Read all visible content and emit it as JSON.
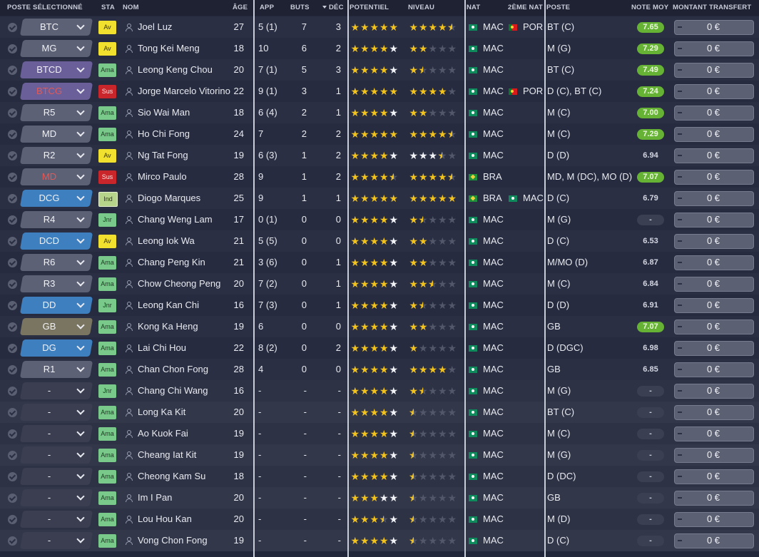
{
  "headers": {
    "poste_sel": "POSTE SÉLECTIONNÉ",
    "sta": "STA",
    "nom": "NOM",
    "age": "ÂGE",
    "app": "APP",
    "buts": "BUTS",
    "dec": "DÉC",
    "potentiel": "POTENTIEL",
    "niveau": "NIVEAU",
    "nat": "NAT",
    "nat2": "2ÈME NAT",
    "poste": "POSTE",
    "note": "NOTE MOY",
    "transfert": "MONTANT TRANSFERT"
  },
  "colors": {
    "accent_blue": "#3d7fbf",
    "status_av": "#f1e12e",
    "status_ama": "#79c98a",
    "status_sus": "#c8262a",
    "rating_green": "#66b234",
    "star_gold": "#f2c21d"
  },
  "players": [
    {
      "pos": "BTC",
      "pos_style": "grey",
      "pos_red": false,
      "status": "Av",
      "name": "Joel Luz",
      "age": "27",
      "app": "5 (1)",
      "buts": "7",
      "dec": "3",
      "potential": 5,
      "potential_color": "gold",
      "level": 4.5,
      "nat": "MAC",
      "nat2": "POR",
      "nat2_flag": "por",
      "poste": "BT (C)",
      "note": "7.65",
      "note_style": "good",
      "montant": "0 €"
    },
    {
      "pos": "MG",
      "pos_style": "grey",
      "pos_red": false,
      "status": "Av",
      "name": "Tong Kei Meng",
      "age": "18",
      "app": "10",
      "buts": "6",
      "dec": "2",
      "potential": 4,
      "potential_color": "white",
      "level": 2,
      "nat": "MAC",
      "nat2": "",
      "nat2_flag": "",
      "poste": "M (G)",
      "note": "7.29",
      "note_style": "good",
      "montant": "0 €"
    },
    {
      "pos": "BTCD",
      "pos_style": "purple",
      "pos_red": false,
      "status": "Ama",
      "name": "Leong Keng Chou",
      "age": "20",
      "app": "7 (1)",
      "buts": "5",
      "dec": "3",
      "potential": 4,
      "potential_color": "white",
      "level": 1.5,
      "nat": "MAC",
      "nat2": "",
      "nat2_flag": "",
      "poste": "BT (C)",
      "note": "7.49",
      "note_style": "good",
      "montant": "0 €"
    },
    {
      "pos": "BTCG",
      "pos_style": "purple",
      "pos_red": true,
      "status": "Sus",
      "name": "Jorge Marcelo Vitorino",
      "age": "22",
      "app": "9 (1)",
      "buts": "3",
      "dec": "1",
      "potential": 5,
      "potential_color": "gold",
      "level": 4,
      "nat": "MAC",
      "nat2": "POR",
      "nat2_flag": "por",
      "poste": "D (C), BT (C)",
      "note": "7.24",
      "note_style": "good",
      "montant": "0 €"
    },
    {
      "pos": "R5",
      "pos_style": "grey",
      "pos_red": false,
      "status": "Ama",
      "name": "Sio Wai Man",
      "age": "18",
      "app": "6 (4)",
      "buts": "2",
      "dec": "1",
      "potential": 4,
      "potential_color": "white",
      "level": 2,
      "nat": "MAC",
      "nat2": "",
      "nat2_flag": "",
      "poste": "M (C)",
      "note": "7.00",
      "note_style": "good",
      "montant": "0 €"
    },
    {
      "pos": "MD",
      "pos_style": "grey",
      "pos_red": false,
      "status": "Ama",
      "name": "Ho Chi Fong",
      "age": "24",
      "app": "7",
      "buts": "2",
      "dec": "2",
      "potential": 5,
      "potential_color": "gold",
      "level": 4.5,
      "nat": "MAC",
      "nat2": "",
      "nat2_flag": "",
      "poste": "M (C)",
      "note": "7.29",
      "note_style": "good",
      "montant": "0 €"
    },
    {
      "pos": "R2",
      "pos_style": "grey",
      "pos_red": false,
      "status": "Av",
      "name": "Ng Tat Fong",
      "age": "19",
      "app": "6 (3)",
      "buts": "1",
      "dec": "2",
      "potential": 4,
      "potential_color": "white",
      "level": 3.5,
      "level_grey": true,
      "nat": "MAC",
      "nat2": "",
      "nat2_flag": "",
      "poste": "D (D)",
      "note": "6.94",
      "note_style": "plain",
      "montant": "0 €"
    },
    {
      "pos": "MD",
      "pos_style": "grey",
      "pos_red": true,
      "status": "Sus",
      "name": "Mirco Paulo",
      "age": "28",
      "app": "9",
      "buts": "1",
      "dec": "2",
      "potential": 4.5,
      "potential_color": "gold",
      "level": 4.5,
      "nat": "BRA",
      "nat_flag": "bra",
      "nat2": "",
      "nat2_flag": "",
      "poste": "MD, M (DC), MO (D)",
      "note": "7.07",
      "note_style": "good",
      "montant": "0 €"
    },
    {
      "pos": "DCG",
      "pos_style": "blue",
      "pos_red": false,
      "status": "Ind",
      "name": "Diogo Marques",
      "age": "25",
      "app": "9",
      "buts": "1",
      "dec": "1",
      "potential": 5,
      "potential_color": "gold",
      "level": 5,
      "nat": "BRA",
      "nat_flag": "bra",
      "nat2": "MAC",
      "nat2_flag": "mac",
      "poste": "D (C)",
      "note": "6.79",
      "note_style": "plain",
      "montant": "0 €"
    },
    {
      "pos": "R4",
      "pos_style": "grey",
      "pos_red": false,
      "status": "Jnr",
      "name": "Chang Weng Lam",
      "age": "17",
      "app": "0 (1)",
      "buts": "0",
      "dec": "0",
      "potential": 4,
      "potential_color": "white",
      "level": 1.5,
      "nat": "MAC",
      "nat2": "",
      "nat2_flag": "",
      "poste": "M (G)",
      "note": "-",
      "note_style": "dash",
      "montant": "0 €"
    },
    {
      "pos": "DCD",
      "pos_style": "blue",
      "pos_red": false,
      "status": "Av",
      "name": "Leong Iok Wa",
      "age": "21",
      "app": "5 (5)",
      "buts": "0",
      "dec": "0",
      "potential": 4,
      "potential_color": "white",
      "level": 2,
      "nat": "MAC",
      "nat2": "",
      "nat2_flag": "",
      "poste": "D (C)",
      "note": "6.53",
      "note_style": "plain",
      "montant": "0 €"
    },
    {
      "pos": "R6",
      "pos_style": "grey",
      "pos_red": false,
      "status": "Ama",
      "name": "Chang Peng Kin",
      "age": "21",
      "app": "3 (6)",
      "buts": "0",
      "dec": "1",
      "potential": 4,
      "potential_color": "white",
      "level": 2,
      "nat": "MAC",
      "nat2": "",
      "nat2_flag": "",
      "poste": "M/MO (D)",
      "note": "6.87",
      "note_style": "plain",
      "montant": "0 €"
    },
    {
      "pos": "R3",
      "pos_style": "grey",
      "pos_red": false,
      "status": "Ama",
      "name": "Chow Cheong Peng",
      "age": "20",
      "app": "7 (2)",
      "buts": "0",
      "dec": "1",
      "potential": 4,
      "potential_color": "white",
      "level": 2.5,
      "nat": "MAC",
      "nat2": "",
      "nat2_flag": "",
      "poste": "M (C)",
      "note": "6.84",
      "note_style": "plain",
      "montant": "0 €"
    },
    {
      "pos": "DD",
      "pos_style": "blue",
      "pos_red": false,
      "status": "Jnr",
      "name": "Leong Kan Chi",
      "age": "16",
      "app": "7 (3)",
      "buts": "0",
      "dec": "1",
      "potential": 4,
      "potential_color": "white",
      "level": 1.5,
      "nat": "MAC",
      "nat2": "",
      "nat2_flag": "",
      "poste": "D (D)",
      "note": "6.91",
      "note_style": "plain",
      "montant": "0 €"
    },
    {
      "pos": "GB",
      "pos_style": "olive",
      "pos_red": false,
      "status": "Ama",
      "name": "Kong Ka Heng",
      "age": "19",
      "app": "6",
      "buts": "0",
      "dec": "0",
      "potential": 4,
      "potential_color": "white",
      "level": 2,
      "nat": "MAC",
      "nat2": "",
      "nat2_flag": "",
      "poste": "GB",
      "note": "7.07",
      "note_style": "good",
      "montant": "0 €"
    },
    {
      "pos": "DG",
      "pos_style": "blue",
      "pos_red": false,
      "status": "Ama",
      "name": "Lai Chi Hou",
      "age": "22",
      "app": "8 (2)",
      "buts": "0",
      "dec": "2",
      "potential": 4,
      "potential_color": "white",
      "level": 1,
      "nat": "MAC",
      "nat2": "",
      "nat2_flag": "",
      "poste": "D (DGC)",
      "note": "6.98",
      "note_style": "plain",
      "montant": "0 €"
    },
    {
      "pos": "R1",
      "pos_style": "grey",
      "pos_red": false,
      "status": "Ama",
      "name": "Chan Chon Fong",
      "age": "28",
      "app": "4",
      "buts": "0",
      "dec": "0",
      "potential": 4,
      "potential_color": "white",
      "level": 4,
      "nat": "MAC",
      "nat2": "",
      "nat2_flag": "",
      "poste": "GB",
      "note": "6.85",
      "note_style": "plain",
      "montant": "0 €"
    },
    {
      "pos": "-",
      "pos_style": "empty",
      "pos_red": false,
      "status": "Jnr",
      "name": "Chang Chi Wang",
      "age": "16",
      "app": "-",
      "buts": "-",
      "dec": "-",
      "potential": 4,
      "potential_color": "white",
      "level": 1.5,
      "nat": "MAC",
      "nat2": "",
      "nat2_flag": "",
      "poste": "M (G)",
      "note": "-",
      "note_style": "dash",
      "montant": "0 €"
    },
    {
      "pos": "-",
      "pos_style": "empty",
      "pos_red": false,
      "status": "Ama",
      "name": "Long Ka Kit",
      "age": "20",
      "app": "-",
      "buts": "-",
      "dec": "-",
      "potential": 4,
      "potential_color": "white",
      "level": 0.5,
      "nat": "MAC",
      "nat2": "",
      "nat2_flag": "",
      "poste": "BT (C)",
      "note": "-",
      "note_style": "dash",
      "montant": "0 €"
    },
    {
      "pos": "-",
      "pos_style": "empty",
      "pos_red": false,
      "status": "Ama",
      "name": "Ao Kuok Fai",
      "age": "19",
      "app": "-",
      "buts": "-",
      "dec": "-",
      "potential": 4,
      "potential_color": "white",
      "level": 0.5,
      "nat": "MAC",
      "nat2": "",
      "nat2_flag": "",
      "poste": "M (C)",
      "note": "-",
      "note_style": "dash",
      "montant": "0 €"
    },
    {
      "pos": "-",
      "pos_style": "empty",
      "pos_red": false,
      "status": "Ama",
      "name": "Cheang Iat Kit",
      "age": "19",
      "app": "-",
      "buts": "-",
      "dec": "-",
      "potential": 4,
      "potential_color": "white",
      "level": 0.5,
      "nat": "MAC",
      "nat2": "",
      "nat2_flag": "",
      "poste": "M (G)",
      "note": "-",
      "note_style": "dash",
      "montant": "0 €"
    },
    {
      "pos": "-",
      "pos_style": "empty",
      "pos_red": false,
      "status": "Ama",
      "name": "Cheong Kam Su",
      "age": "18",
      "app": "-",
      "buts": "-",
      "dec": "-",
      "potential": 4,
      "potential_color": "white",
      "level": 0.5,
      "nat": "MAC",
      "nat2": "",
      "nat2_flag": "",
      "poste": "D (DC)",
      "note": "-",
      "note_style": "dash",
      "montant": "0 €"
    },
    {
      "pos": "-",
      "pos_style": "empty",
      "pos_red": false,
      "status": "Ama",
      "name": "Im I Pan",
      "age": "20",
      "app": "-",
      "buts": "-",
      "dec": "-",
      "potential": 3,
      "potential_color": "white",
      "level": 0.5,
      "nat": "MAC",
      "nat2": "",
      "nat2_flag": "",
      "poste": "GB",
      "note": "-",
      "note_style": "dash",
      "montant": "0 €"
    },
    {
      "pos": "-",
      "pos_style": "empty",
      "pos_red": false,
      "status": "Ama",
      "name": "Lou Hou Kan",
      "age": "20",
      "app": "-",
      "buts": "-",
      "dec": "-",
      "potential": 3.5,
      "potential_color": "white",
      "level": 0.5,
      "nat": "MAC",
      "nat2": "",
      "nat2_flag": "",
      "poste": "M (D)",
      "note": "-",
      "note_style": "dash",
      "montant": "0 €"
    },
    {
      "pos": "-",
      "pos_style": "empty",
      "pos_red": false,
      "status": "Ama",
      "name": "Vong Chon Fong",
      "age": "19",
      "app": "-",
      "buts": "-",
      "dec": "-",
      "potential": 4,
      "potential_color": "white",
      "level": 0.5,
      "nat": "MAC",
      "nat2": "",
      "nat2_flag": "",
      "poste": "D (C)",
      "note": "-",
      "note_style": "dash",
      "montant": "0 €"
    }
  ]
}
